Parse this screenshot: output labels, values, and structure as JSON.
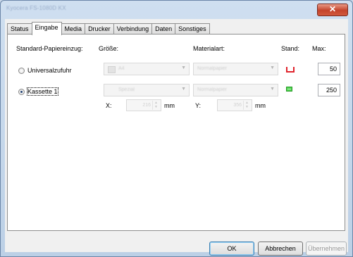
{
  "window": {
    "title": "Kyocera FS-1080D KX",
    "close_label": "✕"
  },
  "tabs": [
    {
      "label": "Status"
    },
    {
      "label": "Eingabe"
    },
    {
      "label": "Media"
    },
    {
      "label": "Drucker"
    },
    {
      "label": "Verbindung"
    },
    {
      "label": "Daten"
    },
    {
      "label": "Sonstiges"
    }
  ],
  "headers": {
    "source": "Standard-Papiereinzug:",
    "size": "Größe:",
    "material": "Materialart:",
    "status": "Stand:",
    "max": "Max:"
  },
  "rows": [
    {
      "label": "Universalzufuhr",
      "selected": false,
      "size_value": "A4",
      "material_value": "Normalpapier",
      "status": "empty",
      "status_color": "#e0242d",
      "max": "50"
    },
    {
      "label": "Kassette 1",
      "selected": true,
      "size_value": "Spezial",
      "material_value": "Normalpapier",
      "status": "filled",
      "status_color": "#4fd24f",
      "max": "250"
    }
  ],
  "custom_size": {
    "x_label": "X:",
    "x_value": "216",
    "x_unit": "mm",
    "y_label": "Y:",
    "y_value": "356",
    "y_unit": "mm"
  },
  "buttons": {
    "ok": "OK",
    "cancel": "Abbrechen",
    "apply": "Übernehmen"
  }
}
